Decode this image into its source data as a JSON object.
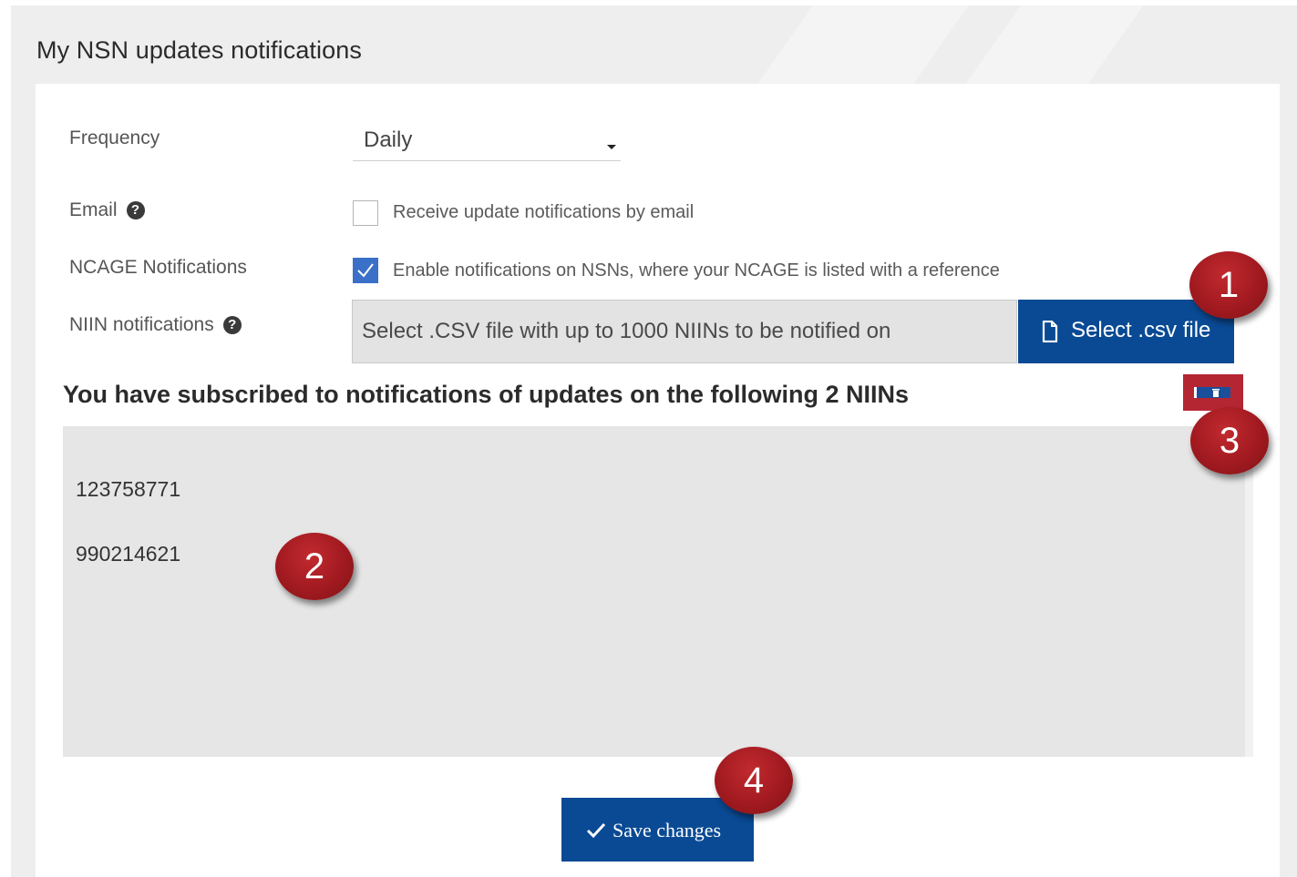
{
  "page_title": "My NSN updates notifications",
  "frequency": {
    "label": "Frequency",
    "selected": "Daily"
  },
  "email": {
    "label": "Email",
    "help_icon": "question-circle-icon",
    "checked": false,
    "checkbox_text": "Receive update notifications by email"
  },
  "ncage": {
    "label": "NCAGE Notifications",
    "checked": true,
    "checkbox_text": "Enable notifications on NSNs, where your NCAGE is listed with a reference"
  },
  "niin": {
    "label": "NIIN notifications",
    "help_icon": "question-circle-icon",
    "file_placeholder": "Select .CSV file with up to 1000 NIINs to be notified on",
    "file_button_label": "Select .csv file",
    "file_button_icon": "file-icon"
  },
  "subscribed": {
    "title": "You have subscribed to notifications of updates on the following 2 NIINs",
    "delete_icon": "trash-icon",
    "items": [
      "123758771",
      "990214621"
    ]
  },
  "save": {
    "label": "Save changes",
    "icon": "checkmark-icon"
  },
  "callouts": [
    "1",
    "2",
    "3",
    "4"
  ],
  "colors": {
    "primary": "#0a4a94",
    "checkbox_checked": "#3a70c8",
    "callout": "#a11a20",
    "delete_button": "#b52633"
  }
}
